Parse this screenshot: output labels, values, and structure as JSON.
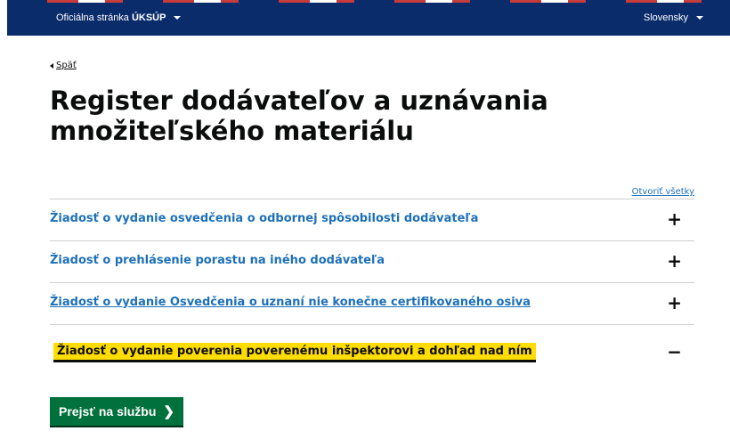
{
  "topbar": {
    "official_prefix": "Oficiálna stránka",
    "official_org": "ÚKSÚP",
    "language": "Slovensky"
  },
  "back_link": "Späť",
  "title": "Register dodávateľov a uznávania množiteľského materiálu",
  "accordion": {
    "open_all": "Otvoriť všetky",
    "sections": [
      {
        "heading": "Žiadosť o vydanie osvedčenia o odbornej spôsobilosti dodávateľa",
        "icon": "+"
      },
      {
        "heading": "Žiadosť o prehlásenie porastu na iného dodávateľa",
        "icon": "+"
      },
      {
        "heading": "Žiadosť o vydanie Osvedčenia o uznaní nie konečne certifikovaného osiva",
        "icon": "+"
      },
      {
        "heading": "Žiadosť o vydanie poverenia poverenému inšpektorovi a dohľad nad ním",
        "icon": "−"
      }
    ]
  },
  "start_button": "Prejsť na službu",
  "colors": {
    "header_bg": "#0b2c6b",
    "link": "#1d70b8",
    "focus": "#ffdd00",
    "button": "#00703c"
  }
}
